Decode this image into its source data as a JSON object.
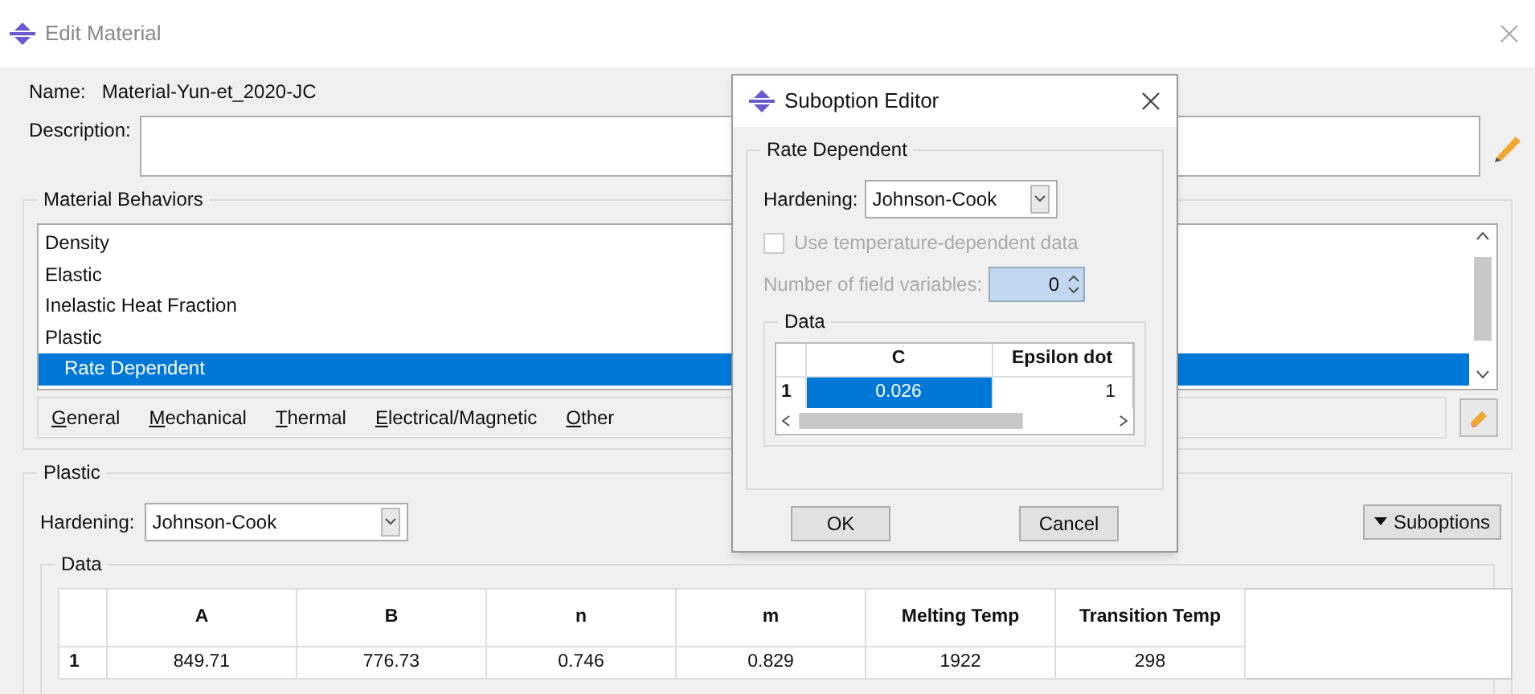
{
  "window": {
    "title": "Edit Material"
  },
  "name": {
    "label": "Name:",
    "value": "Material-Yun-et_2020-JC"
  },
  "description": {
    "label": "Description:"
  },
  "behaviors": {
    "title": "Material Behaviors",
    "items": [
      {
        "label": "Density",
        "selected": false
      },
      {
        "label": "Elastic",
        "selected": false
      },
      {
        "label": "Inelastic Heat Fraction",
        "selected": false
      },
      {
        "label": "Plastic",
        "selected": false,
        "children": [
          {
            "label": "Rate Dependent",
            "selected": true
          }
        ]
      }
    ]
  },
  "menu": [
    "General",
    "Mechanical",
    "Thermal",
    "Electrical/Magnetic",
    "Other"
  ],
  "plastic": {
    "title": "Plastic",
    "hardening_label": "Hardening:",
    "hardening": "Johnson-Cook",
    "suboptions": "Suboptions",
    "data_title": "Data",
    "columns": [
      "A",
      "B",
      "n",
      "m",
      "Melting Temp",
      "Transition Temp"
    ],
    "rows": [
      {
        "index": "1",
        "cells": [
          "849.71",
          "776.73",
          "0.746",
          "0.829",
          "1922",
          "298"
        ]
      }
    ]
  },
  "dialog": {
    "title": "Suboption Editor",
    "group": "Rate Dependent",
    "hardening_label": "Hardening:",
    "hardening": "Johnson-Cook",
    "temperature": {
      "label": "Use temperature-dependent data",
      "checked": false,
      "disabled": true
    },
    "field_variables": {
      "label": "Number of field variables:",
      "value": "0",
      "disabled": true
    },
    "data_title": "Data",
    "columns": [
      "C",
      "Epsilon dot"
    ],
    "rows": [
      {
        "index": "1",
        "cells": [
          {
            "value": "0.026",
            "selected": true
          },
          {
            "value": "1",
            "selected": false
          }
        ]
      }
    ],
    "buttons": [
      "OK",
      "Cancel"
    ]
  }
}
